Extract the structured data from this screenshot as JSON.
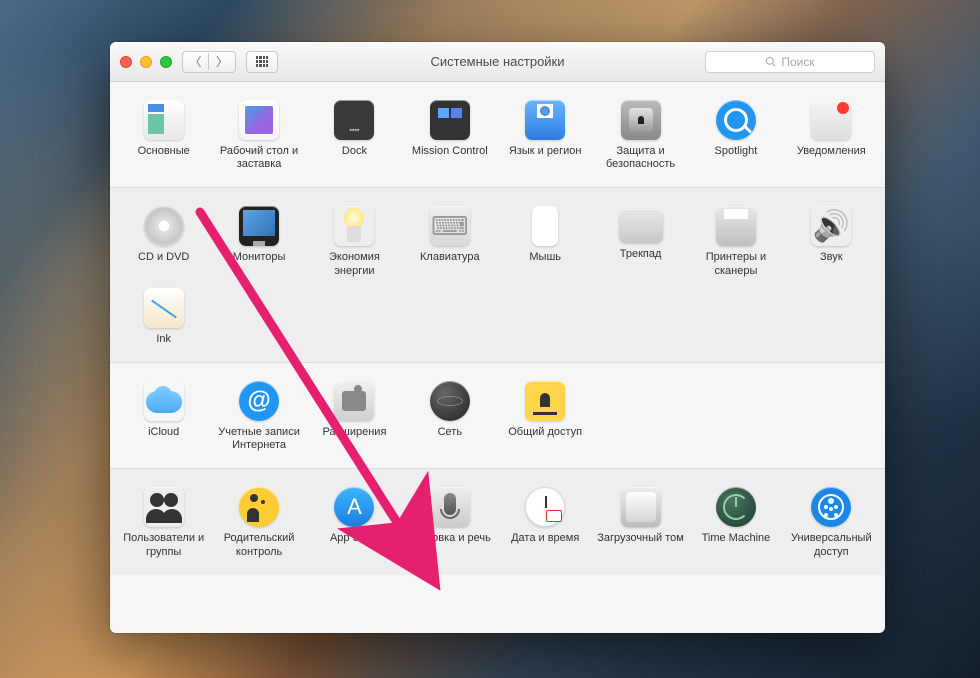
{
  "window": {
    "title": "Системные настройки",
    "search_placeholder": "Поиск"
  },
  "sections": [
    {
      "items": [
        {
          "id": "general",
          "label": "Основные"
        },
        {
          "id": "desktop",
          "label": "Рабочий стол и заставка"
        },
        {
          "id": "dock",
          "label": "Dock"
        },
        {
          "id": "mission",
          "label": "Mission Control"
        },
        {
          "id": "lang",
          "label": "Язык и регион"
        },
        {
          "id": "security",
          "label": "Защита и безопасность"
        },
        {
          "id": "spotlight",
          "label": "Spotlight"
        },
        {
          "id": "notif",
          "label": "Уведомления"
        }
      ]
    },
    {
      "items": [
        {
          "id": "cd",
          "label": "CD и DVD"
        },
        {
          "id": "display",
          "label": "Мониторы"
        },
        {
          "id": "energy",
          "label": "Экономия энергии"
        },
        {
          "id": "keyboard",
          "label": "Клавиатура"
        },
        {
          "id": "mouse",
          "label": "Мышь"
        },
        {
          "id": "trackpad",
          "label": "Трекпад"
        },
        {
          "id": "printer",
          "label": "Принтеры и сканеры"
        },
        {
          "id": "sound",
          "label": "Звук"
        },
        {
          "id": "ink",
          "label": "Ink"
        }
      ]
    },
    {
      "items": [
        {
          "id": "icloud",
          "label": "iCloud"
        },
        {
          "id": "accounts",
          "label": "Учетные записи Интернета"
        },
        {
          "id": "ext",
          "label": "Расширения"
        },
        {
          "id": "network",
          "label": "Сеть"
        },
        {
          "id": "sharing",
          "label": "Общий доступ"
        }
      ]
    },
    {
      "items": [
        {
          "id": "users",
          "label": "Пользователи и группы"
        },
        {
          "id": "parental",
          "label": "Родительский контроль"
        },
        {
          "id": "appstore",
          "label": "App Store"
        },
        {
          "id": "dictation",
          "label": "Диктовка и речь"
        },
        {
          "id": "datetime",
          "label": "Дата и время"
        },
        {
          "id": "startup",
          "label": "Загрузочный том"
        },
        {
          "id": "timemachine",
          "label": "Time Machine"
        },
        {
          "id": "accessibility",
          "label": "Универсальный доступ"
        }
      ]
    }
  ],
  "annotation": {
    "target": "appstore"
  }
}
